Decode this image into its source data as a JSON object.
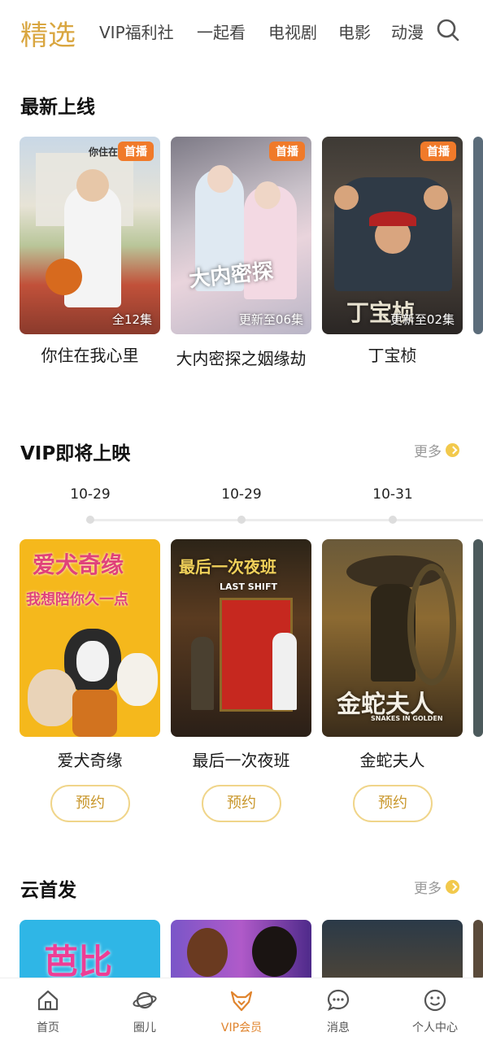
{
  "top_tabs": [
    "精选",
    "VIP福利社",
    "一起看",
    "电视剧",
    "电影",
    "动漫"
  ],
  "sections": {
    "latest": {
      "title": "最新上线",
      "items": [
        {
          "title": "你住在我心里",
          "badge": "首播",
          "episodes": "全12集",
          "art": "你住在"
        },
        {
          "title": "大内密探之姻缘劫",
          "badge": "首播",
          "episodes": "更新至06集",
          "art": "大内密探"
        },
        {
          "title": "丁宝桢",
          "badge": "首播",
          "episodes": "更新至02集",
          "art": "丁宝桢"
        }
      ]
    },
    "vip_upcoming": {
      "title": "VIP即将上映",
      "more": "更多",
      "dates": [
        "10-29",
        "10-29",
        "10-31"
      ],
      "items": [
        {
          "title": "爱犬奇缘",
          "button": "预约",
          "art": "爱犬奇缘",
          "art2": "我想陪你久一点"
        },
        {
          "title": "最后一次夜班",
          "button": "预约",
          "art": "最后一次夜班",
          "art2": "LAST SHIFT"
        },
        {
          "title": "金蛇夫人",
          "button": "预约",
          "art": "金蛇夫人",
          "art2": "SNAKES IN GOLDEN"
        }
      ]
    },
    "cloud": {
      "title": "云首发",
      "more": "更多",
      "items": [
        {
          "art": "芭比"
        },
        {
          "art": ""
        },
        {
          "art": ""
        }
      ]
    }
  },
  "bottom_nav": [
    {
      "label": "首页",
      "icon": "home-icon"
    },
    {
      "label": "圈儿",
      "icon": "planet-icon"
    },
    {
      "label": "VIP会员",
      "icon": "vip-fox-icon",
      "active": true
    },
    {
      "label": "消息",
      "icon": "message-icon"
    },
    {
      "label": "个人中心",
      "icon": "smiley-icon"
    }
  ],
  "colors": {
    "accent": "#d9a640",
    "badge": "#f07a2a",
    "active_nav": "#e0842e"
  }
}
